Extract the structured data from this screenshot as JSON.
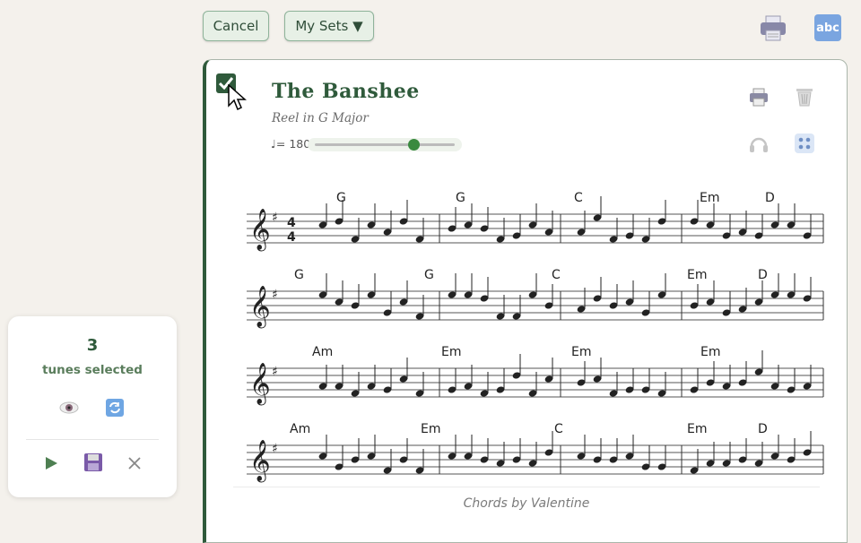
{
  "toolbar": {
    "cancel_label": "Cancel",
    "mysets_label": "My Sets ▼",
    "abc_label": "abc"
  },
  "tune": {
    "title": "The Banshee",
    "subtitle": "Reel in G Major",
    "tempo_label": "♩= 180",
    "tempo_value": 180,
    "attribution": "Chords by Valentine",
    "chords": [
      [
        "G",
        "G",
        "C",
        "Em",
        "D"
      ],
      [
        "G",
        "G",
        "C",
        "Em",
        "D"
      ],
      [
        "Am",
        "Em",
        "Em",
        "Em"
      ],
      [
        "Am",
        "Em",
        "C",
        "Em",
        "D"
      ]
    ]
  },
  "selection": {
    "count": "3",
    "label": "tunes selected"
  },
  "colors": {
    "accent": "#2f5a3b",
    "button_bg": "#e7f0e6",
    "abc_bg": "#7aa5e0",
    "thumb": "#3a8a3f"
  },
  "icons": [
    "print-icon",
    "abc-icon",
    "check-icon",
    "cursor-icon",
    "trash-icon",
    "headphones-icon",
    "grid-icon",
    "eye-icon",
    "refresh-icon",
    "play-icon",
    "save-icon",
    "close-icon"
  ]
}
